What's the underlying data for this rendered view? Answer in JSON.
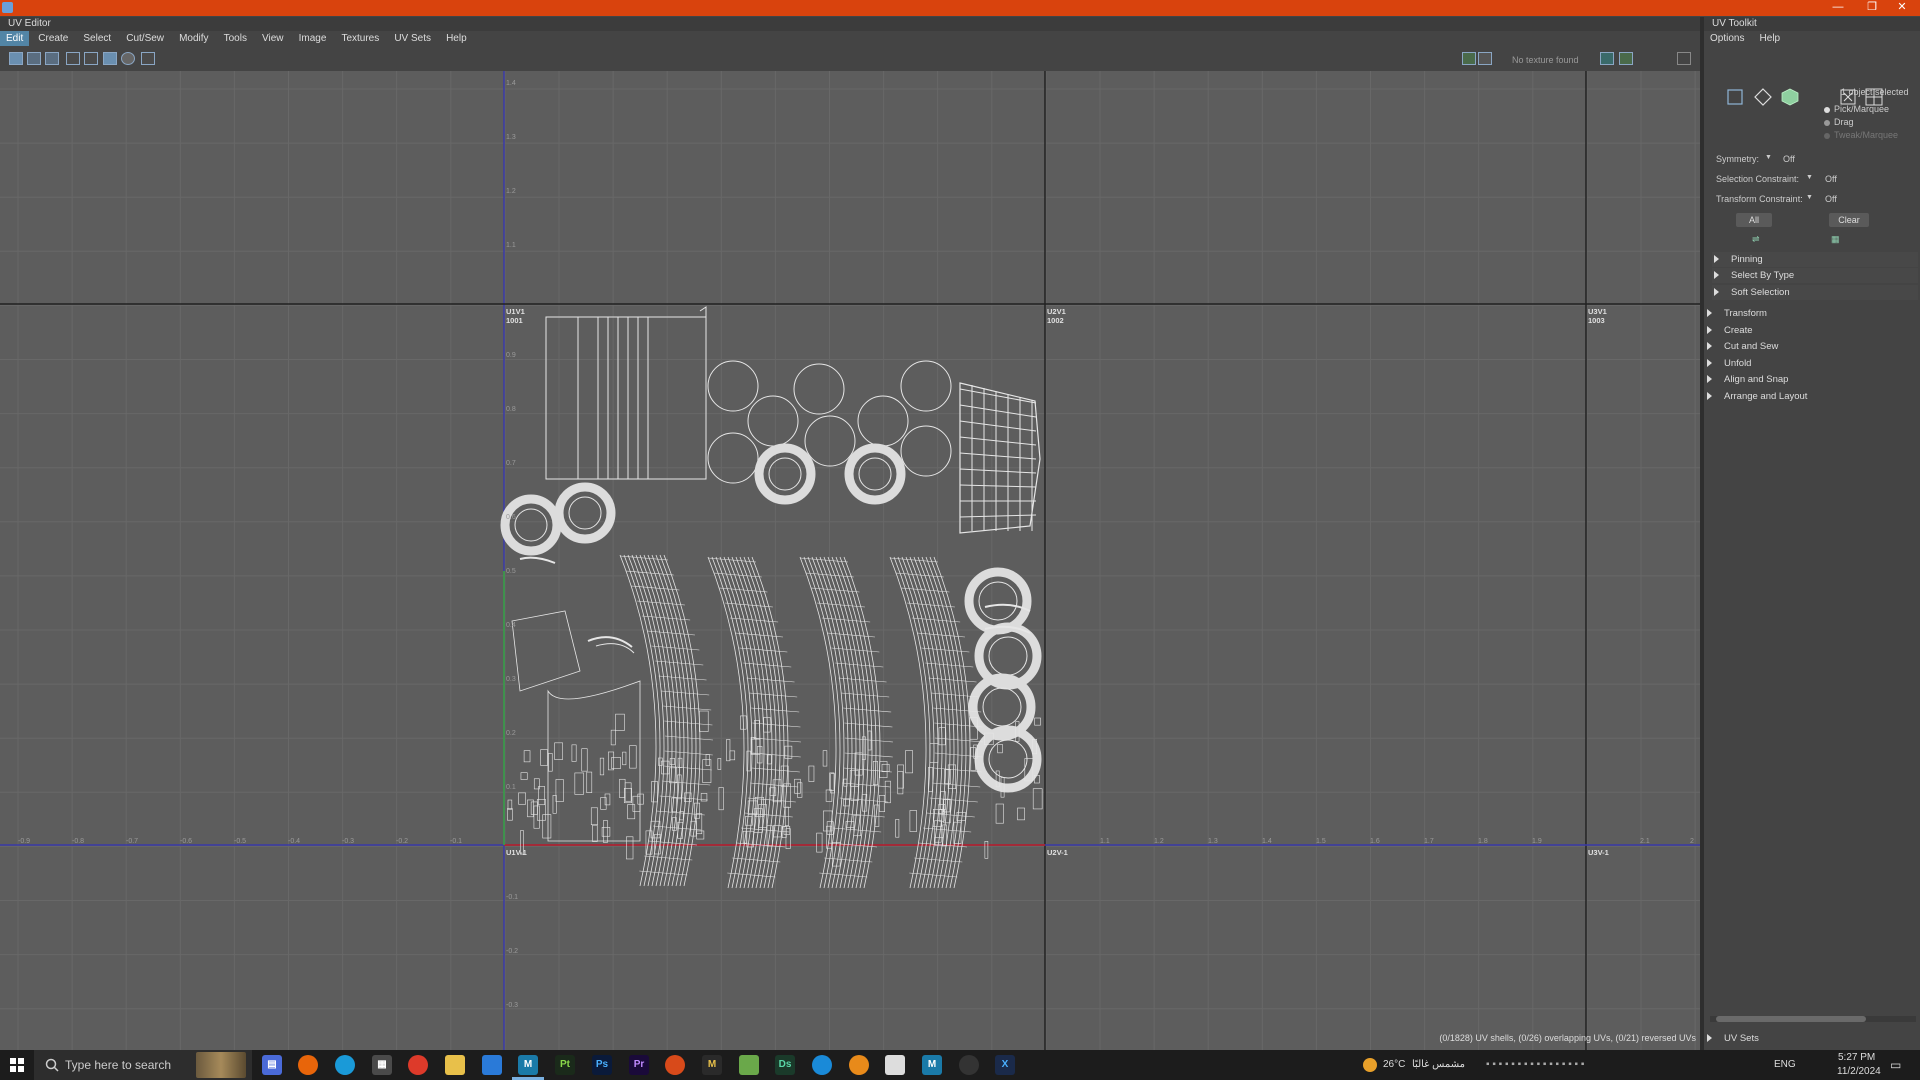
{
  "window": {
    "minimize": "—",
    "restore": "❐",
    "close": "✕"
  },
  "panels": {
    "uv_editor_title": "UV Editor",
    "toolkit_title": "UV Toolkit"
  },
  "menu": [
    "Edit",
    "Create",
    "Select",
    "Cut/Sew",
    "Modify",
    "Tools",
    "View",
    "Image",
    "Textures",
    "UV Sets",
    "Help"
  ],
  "toolbar": {
    "texture_status": "No texture found"
  },
  "viewport": {
    "tile_labels": {
      "u1v1": "U1V1",
      "u1v1_num": "1001",
      "u2v1": "U2V1",
      "u2v1_num": "1002",
      "u3v1": "U3V1",
      "u3v1_num": "1003",
      "u1v_1": "U1V-1",
      "u2v_1": "U2V-1",
      "u3v_1": "U3V-1"
    },
    "v_ticks": [
      "1.4",
      "1.3",
      "1.2",
      "1.1",
      "0.9",
      "0.8",
      "0.7",
      "0.6",
      "0.5",
      "0.4",
      "0.3",
      "0.2",
      "0.1",
      "-0.1",
      "-0.2",
      "-0.3"
    ],
    "u_ticks": [
      "-0.9",
      "-0.8",
      "-0.7",
      "-0.6",
      "-0.5",
      "-0.4",
      "-0.3",
      "-0.2",
      "-0.1",
      "1.1",
      "1.2",
      "1.3",
      "1.4",
      "1.5",
      "1.6",
      "1.7",
      "1.8",
      "1.9",
      "2.1",
      "2"
    ],
    "status": "(0/1828) UV shells, (0/26) overlapping UVs, (0/21) reversed UVs"
  },
  "toolkit": {
    "menu": [
      "Options",
      "Help"
    ],
    "selection_count": "1 object selected",
    "modes": [
      "Pick/Marquee",
      "Drag",
      "Tweak/Marquee"
    ],
    "symmetry_label": "Symmetry:",
    "symmetry_value": "Off",
    "sel_constraint_label": "Selection Constraint:",
    "sel_constraint_value": "Off",
    "xform_constraint_label": "Transform Constraint:",
    "xform_constraint_value": "Off",
    "all_button": "All",
    "clear_button": "Clear",
    "sub_sections": [
      "Pinning",
      "Select By Type",
      "Soft Selection"
    ],
    "sections": [
      "Transform",
      "Create",
      "Cut and Sew",
      "Unfold",
      "Align and Snap",
      "Arrange and Layout"
    ],
    "uv_sets": "UV Sets"
  },
  "taskbar": {
    "search_placeholder": "Type here to search",
    "apps": [
      "Pt",
      "Ps",
      "Pr",
      "Ds",
      "M"
    ],
    "weather": "26°C",
    "weather_text": "مشمس غالبًا",
    "language": "ENG",
    "time": "5:27 PM",
    "date": "11/2/2024"
  },
  "colors": {
    "titlebar": "#d9430d",
    "viewport": "#5d5d5d",
    "uv_lines": "#e6e6e6",
    "axis_blue": "#3a3aa8",
    "select_blue": "#5285a6"
  }
}
